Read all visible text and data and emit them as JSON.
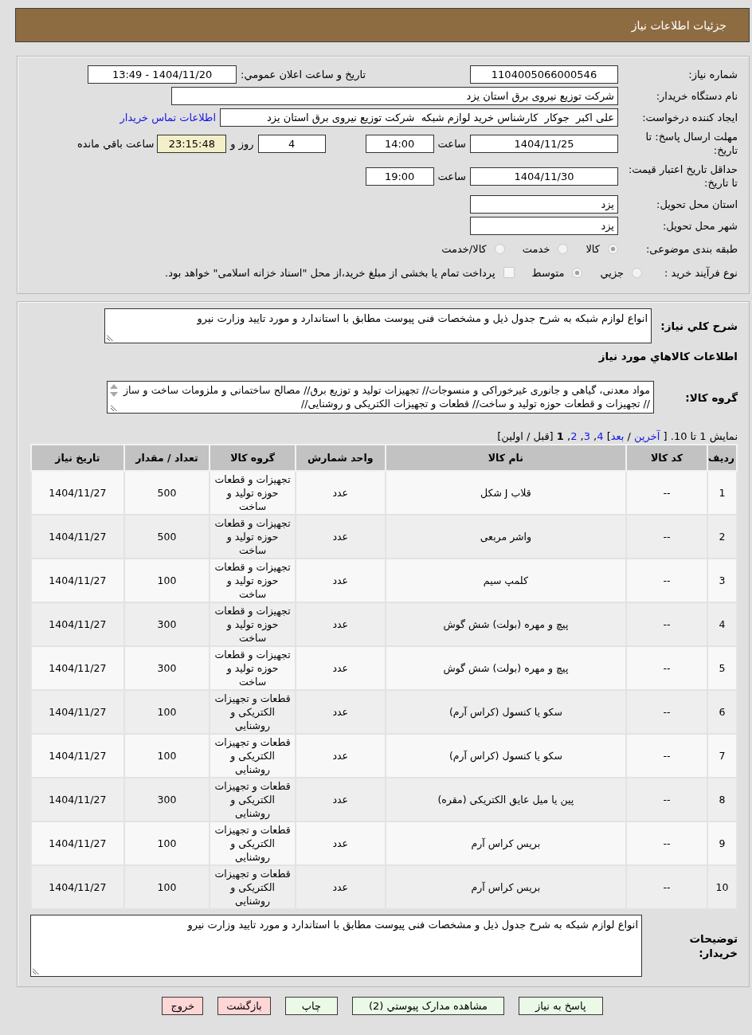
{
  "header": {
    "title": "جزئیات اطلاعات نیاز"
  },
  "details": {
    "need_number": {
      "label": "شماره نیاز:",
      "value": "1104005066000546"
    },
    "announce_datetime": {
      "label": "تاريخ و ساعت اعلان عمومي:",
      "value": "1404/11/20 - 13:49"
    },
    "buyer_org": {
      "label": "نام دستگاه خريدار:",
      "value": "شرکت توزیع نیروی برق استان یزد"
    },
    "requester": {
      "label": "ایجاد کننده درخواست:",
      "value": "علی اکبر  جوکار  کارشناس خرید لوازم شبکه  شرکت توزیع نیروی برق استان یزد",
      "contact_link": "اطلاعات تماس خريدار"
    },
    "response_deadline": {
      "label": "مهلت ارسال پاسخ: تا تاریخ:",
      "date": "1404/11/25",
      "time_label": "ساعت",
      "time": "14:00",
      "days": "4",
      "days_label": "روز و",
      "remaining": "23:15:48",
      "remaining_label": "ساعت باقي مانده"
    },
    "price_validity": {
      "label": "حداقل تاریخ اعتبار قیمت: تا تاریخ:",
      "date": "1404/11/30",
      "time_label": "ساعت",
      "time": "19:00"
    },
    "delivery_province": {
      "label": "استان محل تحویل:",
      "value": "یزد"
    },
    "delivery_city": {
      "label": "شهر محل تحویل:",
      "value": "یزد"
    },
    "subject_category": {
      "label": "طبقه بندی موضوعی:",
      "options": [
        {
          "label": "كالا",
          "selected": true
        },
        {
          "label": "خدمت",
          "selected": false
        },
        {
          "label": "كالا/خدمت",
          "selected": false
        }
      ]
    },
    "purchase_process": {
      "label": "نوع فرآیند خرید :",
      "options": [
        {
          "label": "جزيي",
          "selected": false
        },
        {
          "label": "متوسط",
          "selected": true
        }
      ],
      "treasury_payment": {
        "checked": false,
        "label": "پرداخت تمام یا بخشی از مبلغ خرید،از محل \"اسناد خزانه اسلامی\" خواهد بود."
      }
    }
  },
  "needs": {
    "description": {
      "label": "شرح کلي نیاز:",
      "value": "انواع لوازم شبکه به شرح جدول ذیل و مشخصات فنی پیوست مطابق با استاندارد و مورد تایید وزارت نیرو"
    },
    "goods_heading": "اطلاعات کالاهاي مورد نیاز",
    "goods_group": {
      "label": "گروه کالا:",
      "value": "مواد معدنی، گیاهی و جانوری غیرخوراکی و منسوجات// تجهیزات تولید و توزیع برق// مصالح ساختمانی و ملزومات ساخت و ساز // تجهیزات و قطعات حوزه تولید و ساخت// قطعات و تجهیزات الکتریکی و روشنایی//"
    },
    "pagination": [
      {
        "kind": "text",
        "text": "نمایش 1 تا 10. [ "
      },
      {
        "kind": "link",
        "text": "آخرین"
      },
      {
        "kind": "text",
        "text": " / "
      },
      {
        "kind": "link",
        "text": "بعد"
      },
      {
        "kind": "text",
        "text": "] "
      },
      {
        "kind": "page",
        "text": "4",
        "selected": false
      },
      {
        "kind": "text",
        "text": ", "
      },
      {
        "kind": "page",
        "text": "3",
        "selected": false
      },
      {
        "kind": "text",
        "text": ", "
      },
      {
        "kind": "page",
        "text": "2",
        "selected": false
      },
      {
        "kind": "text",
        "text": ", "
      },
      {
        "kind": "page",
        "text": "1",
        "selected": true
      },
      {
        "kind": "text",
        "text": " [قبل / اولین]"
      }
    ],
    "table": {
      "columns": [
        "ردیف",
        "کد کالا",
        "نام کالا",
        "واحد شمارش",
        "گروه کالا",
        "تعداد / مقدار",
        "تاریخ نیاز"
      ],
      "rows": [
        [
          "1",
          "--",
          "قلاب J شکل",
          "عدد",
          "تجهیزات و قطعات حوزه تولید و ساخت",
          "500",
          "1404/11/27"
        ],
        [
          "2",
          "--",
          "واشر مربعی",
          "عدد",
          "تجهیزات و قطعات حوزه تولید و ساخت",
          "500",
          "1404/11/27"
        ],
        [
          "3",
          "--",
          "کلمپ سیم",
          "عدد",
          "تجهیزات و قطعات حوزه تولید و ساخت",
          "100",
          "1404/11/27"
        ],
        [
          "4",
          "--",
          "پیچ و مهره (بولت) شش گوش",
          "عدد",
          "تجهیزات و قطعات حوزه تولید و ساخت",
          "300",
          "1404/11/27"
        ],
        [
          "5",
          "--",
          "پیچ و مهره (بولت) شش گوش",
          "عدد",
          "تجهیزات و قطعات حوزه تولید و ساخت",
          "300",
          "1404/11/27"
        ],
        [
          "6",
          "--",
          "سکو یا کنسول (کراس آرم)",
          "عدد",
          "قطعات و تجهیزات الکتریکی و روشنایی",
          "100",
          "1404/11/27"
        ],
        [
          "7",
          "--",
          "سکو یا کنسول (کراس آرم)",
          "عدد",
          "قطعات و تجهیزات الکتریکی و روشنایی",
          "100",
          "1404/11/27"
        ],
        [
          "8",
          "--",
          "پین یا میل عایق الکتریکی (مقره)",
          "عدد",
          "قطعات و تجهیزات الکتریکی و روشنایی",
          "300",
          "1404/11/27"
        ],
        [
          "9",
          "--",
          "بریس کراس آرم",
          "عدد",
          "قطعات و تجهیزات الکتریکی و روشنایی",
          "100",
          "1404/11/27"
        ],
        [
          "10",
          "--",
          "بریس کراس آرم",
          "عدد",
          "قطعات و تجهیزات الکتریکی و روشنایی",
          "100",
          "1404/11/27"
        ]
      ]
    },
    "buyer_notes": {
      "label": "توضیحات خریدار:",
      "value": "انواع لوازم شبکه به شرح جدول ذیل و مشخصات فنی پیوست مطابق با استاندارد و مورد تایید وزارت نیرو"
    }
  },
  "buttons": [
    {
      "label": "پاسخ به نیاز",
      "kind": "action"
    },
    {
      "label": "مشاهده مدارک پیوستي (2)",
      "kind": "action"
    },
    {
      "label": "چاپ",
      "kind": "action"
    },
    {
      "label": "بازگشت",
      "kind": "exit"
    },
    {
      "label": "خروج",
      "kind": "exit"
    }
  ]
}
